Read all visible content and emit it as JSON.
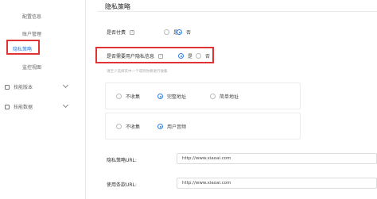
{
  "sidebar": {
    "items": [
      {
        "label": "配置信息"
      },
      {
        "label": "账户管理"
      },
      {
        "label": "隐私策略"
      },
      {
        "label": "监控视图"
      }
    ],
    "groups": [
      {
        "label": "技能版本",
        "icon": "file-icon"
      },
      {
        "label": "技能数据",
        "icon": "chart-icon"
      }
    ]
  },
  "page": {
    "title": "隐私策略"
  },
  "paid": {
    "label": "是否付费",
    "yes": "是",
    "no": "否",
    "selected": "no"
  },
  "user_privacy": {
    "label": "是否需要用户隐私信息",
    "yes": "是",
    "no": "否",
    "selected": "yes"
  },
  "hint": "请至少选择其中一个或到你要进行收集",
  "options_row1": {
    "none": "不收集",
    "full": "完整地址",
    "simple": "简单地址",
    "selected": "full"
  },
  "options_row2": {
    "none": "不收集",
    "audio": "用户音频",
    "selected": "audio"
  },
  "fields": {
    "privacy_url_label": "隐私策略URL:",
    "privacy_url_value": "http://www.xiaoai.com",
    "terms_url_label": "使用条款URL:",
    "terms_url_value": "http://www.xiaoai.com"
  },
  "colors": {
    "accent": "#2f80ed",
    "highlight": "#e03434"
  }
}
